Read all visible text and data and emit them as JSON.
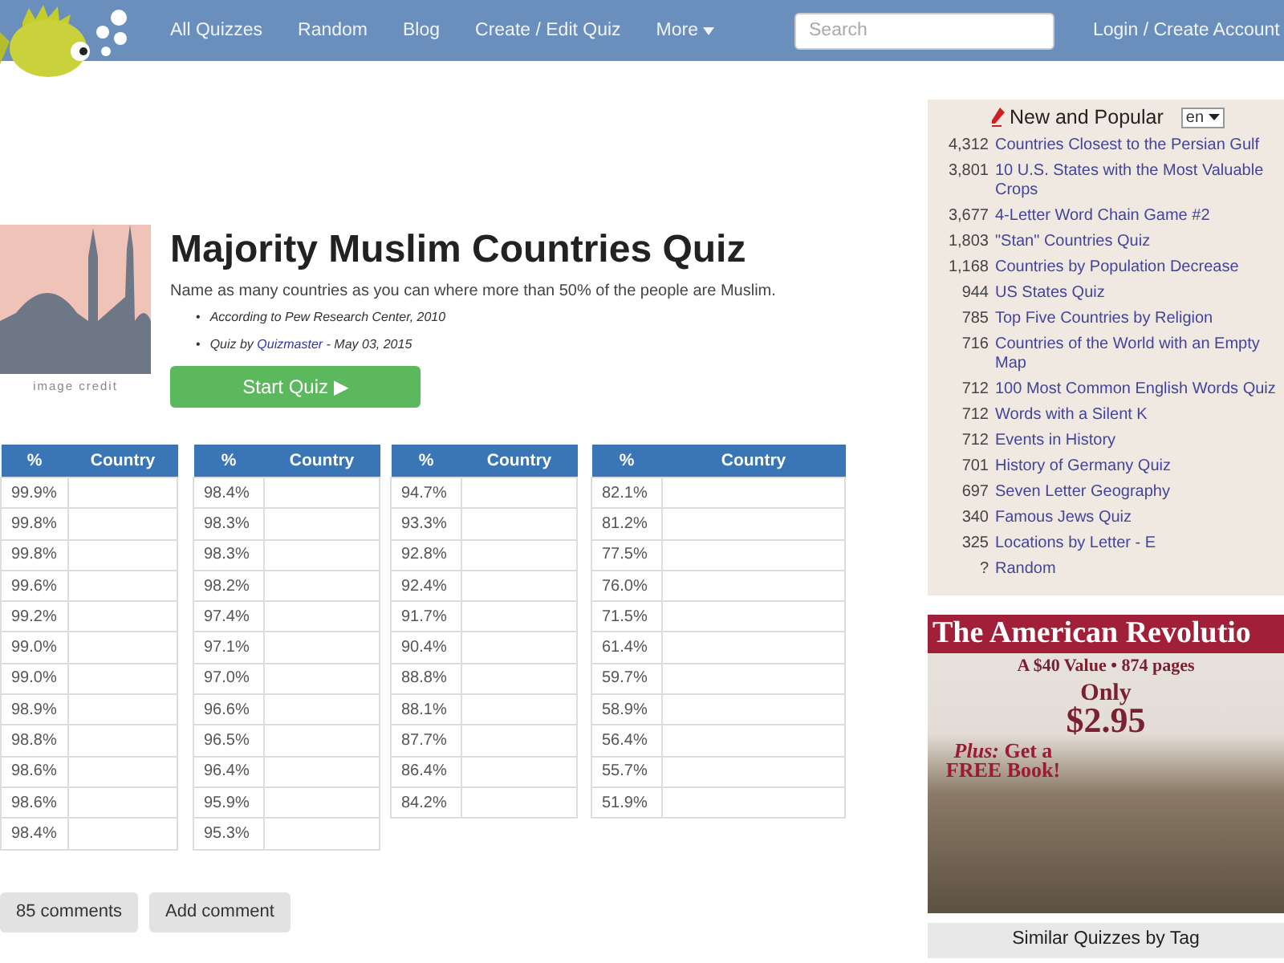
{
  "nav": {
    "links": [
      "All Quizzes",
      "Random",
      "Blog",
      "Create / Edit Quiz"
    ],
    "more": "More",
    "search": {
      "placeholder": "Search"
    },
    "login": "Login / Create Account"
  },
  "quiz": {
    "image_credit": "image credit",
    "title": "Majority Muslim Countries Quiz",
    "description": "Name as many countries as you can where more than 50% of the people are Muslim.",
    "bullet": "•",
    "source": "According to Pew Research Center, 2010",
    "byline_prefix": "Quiz by",
    "author": "Quizmaster",
    "date": "- May 03, 2015",
    "start_button": "Start Quiz ▶"
  },
  "tables": [
    {
      "columns": [
        "%",
        "Country"
      ],
      "rows": [
        "99.9%",
        "99.8%",
        "99.8%",
        "99.6%",
        "99.2%",
        "99.0%",
        "99.0%",
        "98.9%",
        "98.8%",
        "98.6%",
        "98.6%",
        "98.4%"
      ]
    },
    {
      "columns": [
        "%",
        "Country"
      ],
      "rows": [
        "98.4%",
        "98.3%",
        "98.3%",
        "98.2%",
        "97.4%",
        "97.1%",
        "97.0%",
        "96.6%",
        "96.5%",
        "96.4%",
        "95.9%",
        "95.3%"
      ]
    },
    {
      "columns": [
        "%",
        "Country"
      ],
      "rows": [
        "94.7%",
        "93.3%",
        "92.8%",
        "92.4%",
        "91.7%",
        "90.4%",
        "88.8%",
        "88.1%",
        "87.7%",
        "86.4%",
        "84.2%"
      ]
    },
    {
      "columns": [
        "%",
        "Country"
      ],
      "rows": [
        "82.1%",
        "81.2%",
        "77.5%",
        "76.0%",
        "71.5%",
        "61.4%",
        "59.7%",
        "58.9%",
        "56.4%",
        "55.7%",
        "51.9%"
      ]
    }
  ],
  "comment_buttons": [
    "85 comments",
    "Add comment"
  ],
  "sidebar": {
    "title": "New and Popular",
    "language": "en",
    "items": [
      {
        "count": "4,312",
        "title": "Countries Closest to the Persian Gulf"
      },
      {
        "count": "3,801",
        "title": "10 U.S. States with the Most Valuable Crops"
      },
      {
        "count": "3,677",
        "title": "4-Letter Word Chain Game #2"
      },
      {
        "count": "1,803",
        "title": "\"Stan\" Countries Quiz"
      },
      {
        "count": "1,168",
        "title": "Countries by Population Decrease"
      },
      {
        "count": "944",
        "title": "US States Quiz"
      },
      {
        "count": "785",
        "title": "Top Five Countries by Religion"
      },
      {
        "count": "716",
        "title": "Countries of the World with an Empty Map"
      },
      {
        "count": "712",
        "title": "100 Most Common English Words Quiz"
      },
      {
        "count": "712",
        "title": "Words with a Silent K"
      },
      {
        "count": "712",
        "title": "Events in History"
      },
      {
        "count": "701",
        "title": "History of Germany Quiz"
      },
      {
        "count": "697",
        "title": "Seven Letter Geography"
      },
      {
        "count": "340",
        "title": "Famous Jews Quiz"
      },
      {
        "count": "325",
        "title": "Locations by Letter - E"
      },
      {
        "count": "?",
        "title": "Random"
      }
    ]
  },
  "ad": {
    "headline": "The American Revolutio",
    "subline": "A $40 Value • 874 pages",
    "price_label": "Only",
    "price": "$2.95",
    "offer": "*Plus:* Get a FREE Book!"
  },
  "similar": {
    "title": "Similar Quizzes by Tag"
  }
}
